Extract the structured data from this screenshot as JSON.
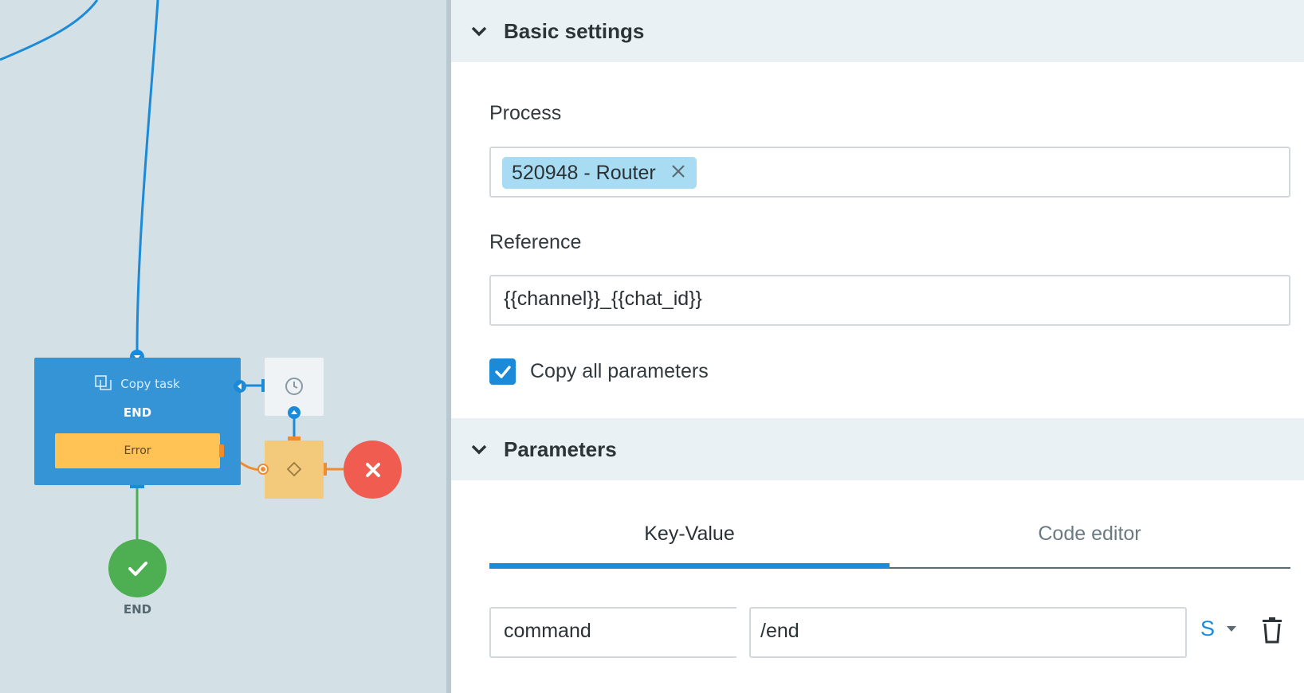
{
  "canvas": {
    "main_node": {
      "title": "Copy task",
      "subtitle": "END",
      "error_label": "Error"
    },
    "end_node": {
      "label": "END"
    },
    "timer_node": {
      "icon": "clock-icon"
    },
    "gate_node": {
      "icon": "diamond-icon"
    },
    "stop_node": {
      "icon": "close-icon"
    },
    "colors": {
      "canvas_bg": "#d3e0e6",
      "node_blue": "#3594d6",
      "error_yellow": "#ffc255",
      "end_green": "#4dae52",
      "stop_red": "#f05d50",
      "wire_blue": "#1b8ad8",
      "wire_orange": "#ef8c2f"
    }
  },
  "panel": {
    "basic_settings": {
      "title": "Basic settings",
      "process": {
        "label": "Process",
        "tag": "520948 - Router"
      },
      "reference": {
        "label": "Reference",
        "value": "{{channel}}_{{chat_id}}"
      },
      "copy_all": {
        "label": "Copy all parameters",
        "checked": true
      }
    },
    "parameters": {
      "title": "Parameters",
      "tabs": [
        {
          "label": "Key-Value",
          "active": true
        },
        {
          "label": "Code editor",
          "active": false
        }
      ],
      "rows": [
        {
          "key": "command",
          "value": "/end",
          "type": "S"
        }
      ]
    },
    "accent": "#1b8ad8"
  }
}
